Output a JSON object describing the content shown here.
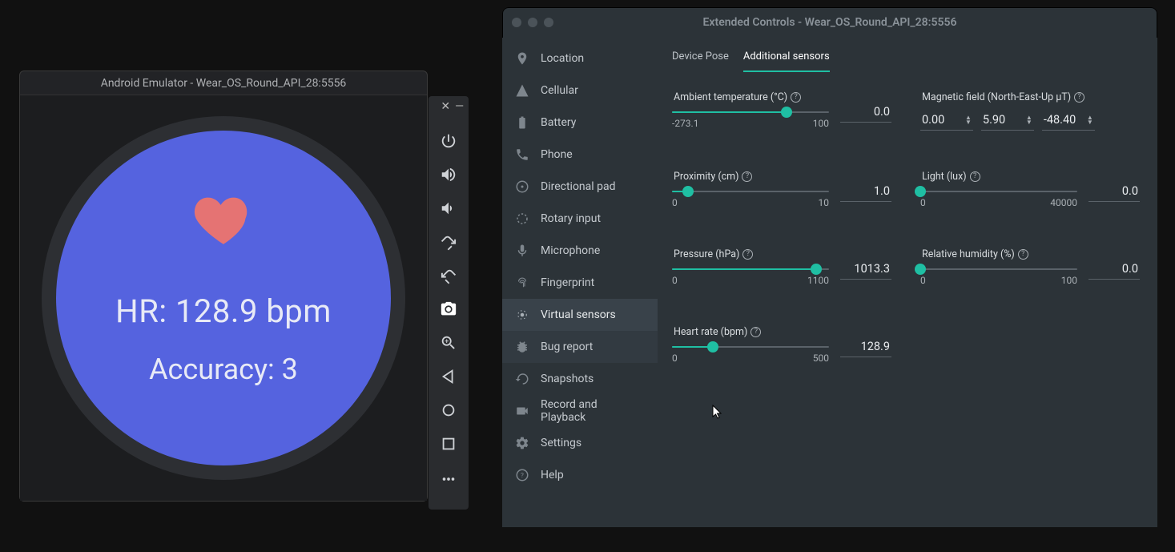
{
  "emulator": {
    "title": "Android Emulator - Wear_OS_Round_API_28:5556",
    "hr_label": "HR: 128.9 bpm",
    "accuracy_label": "Accuracy: 3",
    "toolbar_icons": [
      "power-icon",
      "volume-up-icon",
      "volume-down-icon",
      "rotate-left-icon",
      "rotate-right-icon",
      "camera-icon",
      "zoom-in-icon",
      "back-icon",
      "home-icon",
      "overview-icon",
      "more-icon"
    ]
  },
  "extended": {
    "title": "Extended Controls - Wear_OS_Round_API_28:5556",
    "tabs": {
      "device_pose": "Device Pose",
      "additional_sensors": "Additional sensors"
    },
    "sidebar": [
      {
        "icon": "location-icon",
        "label": "Location"
      },
      {
        "icon": "cellular-icon",
        "label": "Cellular"
      },
      {
        "icon": "battery-icon",
        "label": "Battery"
      },
      {
        "icon": "phone-icon",
        "label": "Phone"
      },
      {
        "icon": "dpad-icon",
        "label": "Directional pad"
      },
      {
        "icon": "rotary-icon",
        "label": "Rotary input"
      },
      {
        "icon": "mic-icon",
        "label": "Microphone"
      },
      {
        "icon": "fingerprint-icon",
        "label": "Fingerprint"
      },
      {
        "icon": "sensors-icon",
        "label": "Virtual sensors"
      },
      {
        "icon": "bug-icon",
        "label": "Bug report"
      },
      {
        "icon": "snapshot-icon",
        "label": "Snapshots"
      },
      {
        "icon": "record-icon",
        "label": "Record and Playback"
      },
      {
        "icon": "settings-icon",
        "label": "Settings"
      },
      {
        "icon": "help-icon",
        "label": "Help"
      }
    ],
    "sensors": {
      "ambient_temp": {
        "label": "Ambient temperature (°C)",
        "min": "-273.1",
        "max": "100",
        "value": "0.0",
        "pct": 73
      },
      "magnetic": {
        "label": "Magnetic field (North-East-Up μT)",
        "x": "0.00",
        "y": "5.90",
        "z": "-48.40"
      },
      "proximity": {
        "label": "Proximity (cm)",
        "min": "0",
        "max": "10",
        "value": "1.0",
        "pct": 10
      },
      "light": {
        "label": "Light (lux)",
        "min": "0",
        "max": "40000",
        "value": "0.0",
        "pct": 0
      },
      "pressure": {
        "label": "Pressure (hPa)",
        "min": "0",
        "max": "1100",
        "value": "1013.3",
        "pct": 92
      },
      "humidity": {
        "label": "Relative humidity (%)",
        "min": "0",
        "max": "100",
        "value": "0.0",
        "pct": 0
      },
      "heart_rate": {
        "label": "Heart rate (bpm)",
        "min": "0",
        "max": "500",
        "value": "128.9",
        "pct": 26
      }
    }
  }
}
